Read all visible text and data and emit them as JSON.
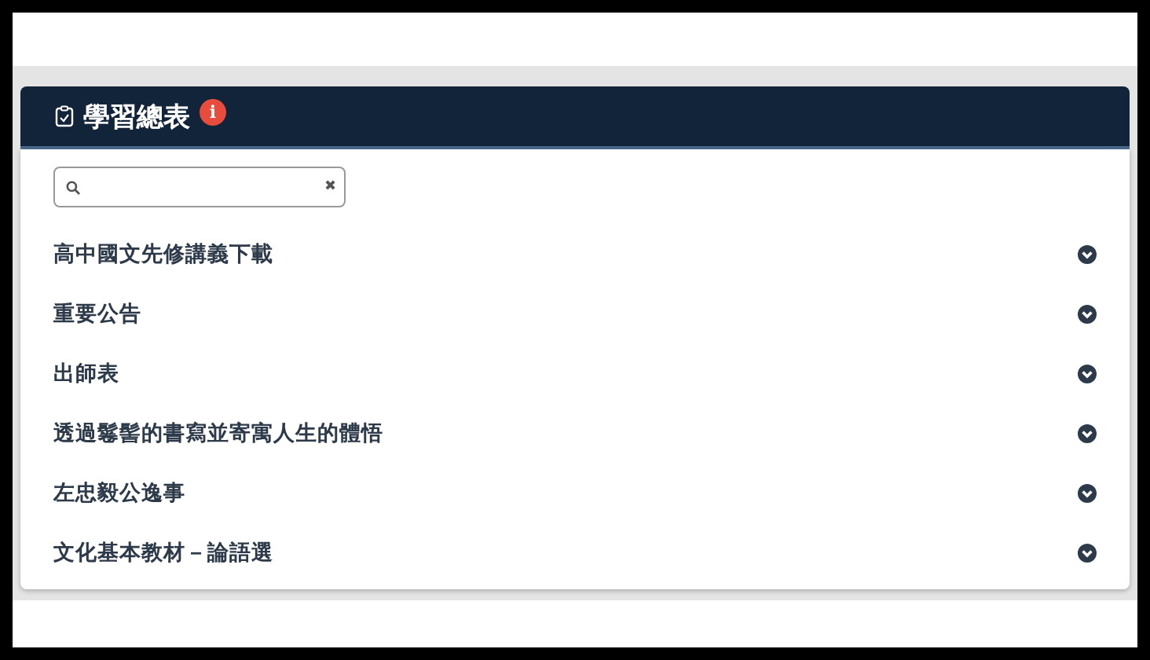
{
  "card": {
    "title": "學習總表",
    "badge": "i"
  },
  "search": {
    "clear": "✖"
  },
  "items": [
    {
      "label": "高中國文先修講義下載",
      "expanded": false
    },
    {
      "label": "重要公告",
      "expanded": false
    },
    {
      "label": "出師表",
      "expanded": false
    },
    {
      "label": "透過鬈髻的書寫並寄寓人生的體悟",
      "expanded": false
    },
    {
      "label": "左忠毅公逸事",
      "expanded": false
    },
    {
      "label": "文化基本教材－論語選",
      "expanded": false
    }
  ]
}
